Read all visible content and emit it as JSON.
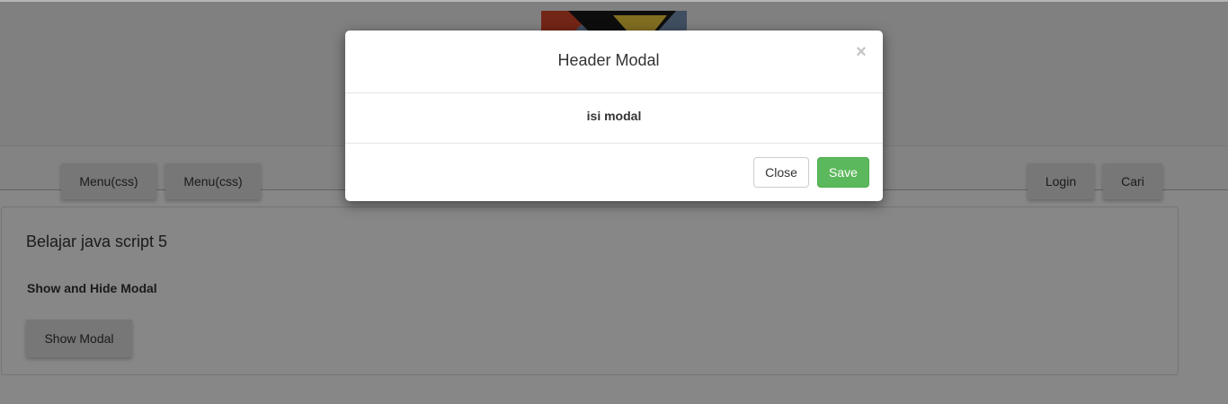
{
  "nav": {
    "menu_1_label": "Menu(css)",
    "menu_2_label": "Menu(css)",
    "login_label": "Login",
    "search_label": "Cari"
  },
  "panel": {
    "title": "Belajar java script 5",
    "subtitle": "Show and Hide Modal",
    "show_button_label": "Show Modal"
  },
  "modal": {
    "title": "Header Modal",
    "close_symbol": "×",
    "body_text": "isi modal",
    "close_button_label": "Close",
    "save_button_label": "Save"
  },
  "colors": {
    "save_button": "#5cb85c",
    "backdrop": "rgba(0,0,0,0.47)"
  },
  "icons": {
    "logo": "logo-image",
    "modal_close": "close-icon"
  }
}
